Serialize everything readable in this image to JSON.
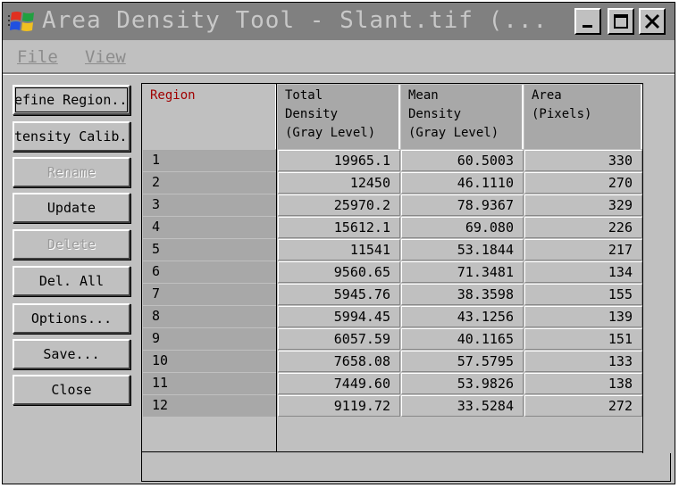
{
  "window": {
    "title": "Area Density Tool - Slant.tif (...",
    "icon": "windows-logo-icon",
    "controls": [
      "minimize-icon",
      "maximize-icon",
      "close-icon"
    ]
  },
  "menu": [
    {
      "label": "File"
    },
    {
      "label": "View"
    }
  ],
  "buttons": [
    {
      "label": "efine Region..",
      "enabled": true,
      "name": "define-region-button"
    },
    {
      "label": "tensity Calib.",
      "enabled": true,
      "name": "density-calib-button"
    },
    {
      "label": "Rename",
      "enabled": false,
      "name": "rename-button"
    },
    {
      "label": "Update",
      "enabled": true,
      "name": "update-button"
    },
    {
      "label": "Delete",
      "enabled": false,
      "name": "delete-button"
    },
    {
      "label": "Del. All",
      "enabled": true,
      "name": "delete-all-button"
    },
    {
      "label": "Options...",
      "enabled": true,
      "name": "options-button"
    },
    {
      "label": "Save...",
      "enabled": true,
      "name": "save-button"
    },
    {
      "label": "Close",
      "enabled": true,
      "name": "close-button"
    }
  ],
  "table": {
    "headers": [
      "Region",
      "Total\nDensity\n(Gray Level)",
      "Mean\nDensity\n(Gray Level)",
      "Area\n(Pixels)"
    ],
    "rows": [
      [
        "1",
        "19965.1",
        "60.5003",
        "330"
      ],
      [
        "2",
        "12450",
        "46.1110",
        "270"
      ],
      [
        "3",
        "25970.2",
        "78.9367",
        "329"
      ],
      [
        "4",
        "15612.1",
        "69.080",
        "226"
      ],
      [
        "5",
        "11541",
        "53.1844",
        "217"
      ],
      [
        "6",
        "9560.65",
        "71.3481",
        "134"
      ],
      [
        "7",
        "5945.76",
        "38.3598",
        "155"
      ],
      [
        "8",
        "5994.45",
        "43.1256",
        "139"
      ],
      [
        "9",
        "6057.59",
        "40.1165",
        "151"
      ],
      [
        "10",
        "7658.08",
        "57.5795",
        "133"
      ],
      [
        "11",
        "7449.60",
        "53.9826",
        "138"
      ],
      [
        "12",
        "9119.72",
        "33.5284",
        "272"
      ]
    ]
  },
  "colors": {
    "face": "#c0c0c0",
    "titlebar": "#808080",
    "region_header": "#a00000"
  }
}
